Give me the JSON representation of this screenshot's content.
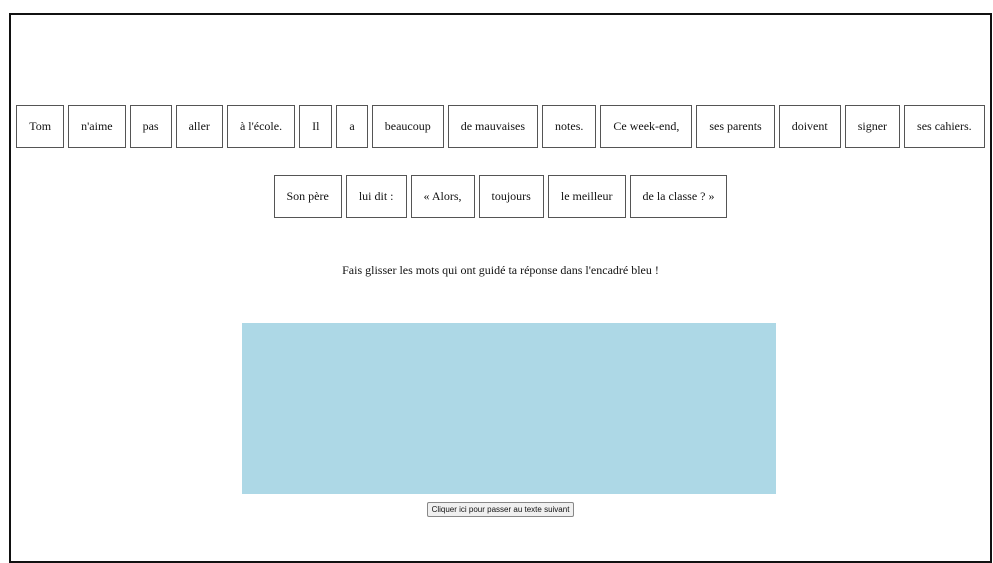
{
  "words_row1": [
    "Tom",
    "n'aime",
    "pas",
    "aller",
    "à l'école.",
    "Il",
    "a",
    "beaucoup",
    "de mauvaises",
    "notes.",
    "Ce week-end,",
    "ses parents",
    "doivent",
    "signer",
    "ses cahiers."
  ],
  "words_row2": [
    "Son père",
    "lui dit :",
    "« Alors,",
    "toujours",
    "le meilleur",
    "de la classe ? »"
  ],
  "instruction": "Fais glisser les mots qui ont guidé ta réponse dans l'encadré bleu !",
  "dropzone": {
    "color": "#add8e6"
  },
  "next_button_label": "Cliquer ici pour passer au texte suivant"
}
